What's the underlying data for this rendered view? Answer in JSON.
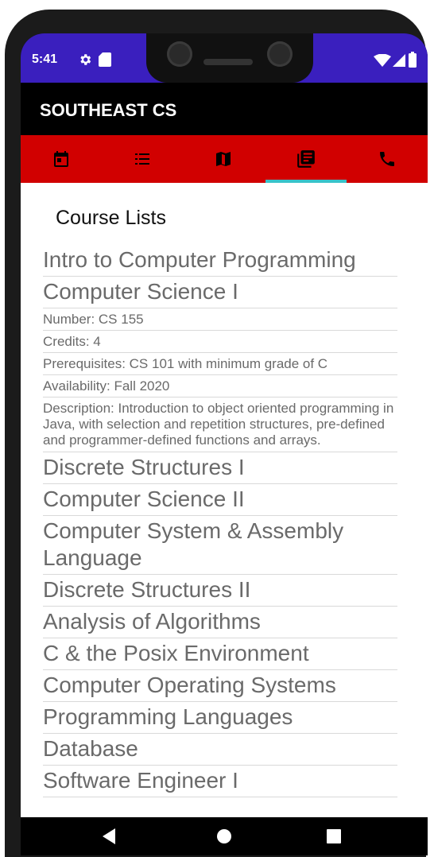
{
  "status": {
    "time": "5:41",
    "icons": [
      "gear-icon",
      "sd-card-icon",
      "wifi-icon",
      "signal-icon",
      "battery-icon"
    ],
    "bar_color": "#3a1fbe"
  },
  "app": {
    "title": "SOUTHEAST CS",
    "toolbar_color": "#000000",
    "tabbar_color": "#d10000",
    "indicator_color": "#39c2c9"
  },
  "tabs": [
    {
      "icon": "calendar-icon",
      "selected": false
    },
    {
      "icon": "list-icon",
      "selected": false
    },
    {
      "icon": "map-icon",
      "selected": false
    },
    {
      "icon": "library-books-icon",
      "selected": true
    },
    {
      "icon": "phone-icon",
      "selected": false
    }
  ],
  "main": {
    "heading": "Course Lists",
    "items": [
      {
        "text": "Intro to Computer Programming",
        "style": "big"
      },
      {
        "text": "Computer Science I",
        "style": "big"
      },
      {
        "text": "Number: CS 155",
        "style": "small"
      },
      {
        "text": "Credits: 4",
        "style": "small"
      },
      {
        "text": "Prerequisites: CS 101 with minimum grade of C",
        "style": "small"
      },
      {
        "text": "Availability: Fall 2020",
        "style": "small"
      },
      {
        "text": "Description: Introduction to object oriented programming in Java, with selection and repetition structures, pre-defined and programmer-defined functions and arrays.",
        "style": "desc"
      },
      {
        "text": "Discrete Structures I",
        "style": "big"
      },
      {
        "text": "Computer Science II",
        "style": "big"
      },
      {
        "text": "Computer System & Assembly Language",
        "style": "big"
      },
      {
        "text": "Discrete Structures II",
        "style": "big"
      },
      {
        "text": "Analysis of Algorithms",
        "style": "big"
      },
      {
        "text": "C & the Posix Environment",
        "style": "big"
      },
      {
        "text": "Computer Operating Systems",
        "style": "big"
      },
      {
        "text": "Programming Languages",
        "style": "big"
      },
      {
        "text": "Database",
        "style": "big"
      },
      {
        "text": "Software Engineer I",
        "style": "big"
      }
    ]
  },
  "navbar": {
    "buttons": [
      "back-icon",
      "home-icon",
      "recents-icon"
    ]
  }
}
